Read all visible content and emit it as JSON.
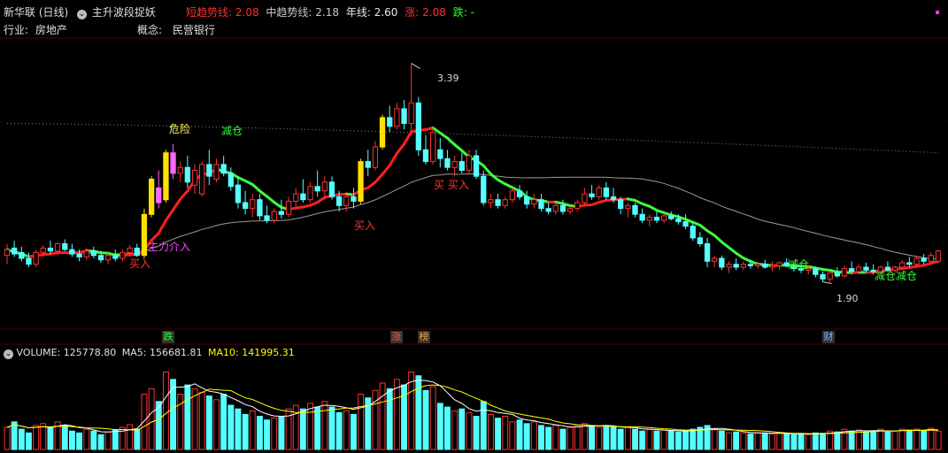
{
  "header": {
    "stock_name": "新华联 (日线)",
    "indicator_name": "主升波段捉妖",
    "short_trend_label": "短趋势线:",
    "short_trend_value": "2.08",
    "mid_trend_label": "中趋势线:",
    "mid_trend_value": "2.18",
    "year_line_label": "年线:",
    "year_line_value": "2.60",
    "rise_label": "涨:",
    "rise_value": "2.08",
    "fall_label": "跌:",
    "fall_value": "-",
    "industry_label": "行业:",
    "industry_value": "房地产",
    "concept_label": "概念:",
    "concept_value": "民营银行"
  },
  "volume_header": {
    "volume_label": "VOLUME:",
    "volume_value": "125778.80",
    "ma5_label": "MA5:",
    "ma5_value": "156681.81",
    "ma10_label": "MA10:",
    "ma10_value": "141995.31"
  },
  "colors": {
    "up": "#ff3232",
    "down": "#54ffff",
    "red_line": "#ff1f1f",
    "green_line": "#3cff3c",
    "year_line": "#9a9a9a",
    "dotted_line": "#707070",
    "yellow_candle": "#ffe000",
    "magenta_candle": "#ff66ff",
    "signal_buy": "#ff3333",
    "signal_reduce": "#33ff33",
    "signal_danger": "#ffff66",
    "signal_main": "#ff44ff",
    "ma5": "#ffffff",
    "ma10": "#ffff00",
    "badge_green": "#33ff33",
    "badge_red": "#ff5555",
    "badge_orange": "#ffa033",
    "badge_blue": "#77aaff"
  },
  "chart_data": {
    "type": "candlestick",
    "ylim": [
      1.65,
      3.55
    ],
    "max_label": "3.39",
    "min_label": "1.90",
    "candles": [
      {
        "o": 2.08,
        "h": 2.16,
        "l": 2.02,
        "c": 2.12
      },
      {
        "o": 2.13,
        "h": 2.18,
        "l": 2.07,
        "c": 2.09
      },
      {
        "o": 2.1,
        "h": 2.14,
        "l": 2.04,
        "c": 2.06
      },
      {
        "o": 2.06,
        "h": 2.1,
        "l": 2.0,
        "c": 2.02
      },
      {
        "o": 2.02,
        "h": 2.12,
        "l": 2.0,
        "c": 2.1
      },
      {
        "o": 2.1,
        "h": 2.15,
        "l": 2.07,
        "c": 2.13
      },
      {
        "o": 2.13,
        "h": 2.18,
        "l": 2.09,
        "c": 2.11
      },
      {
        "o": 2.11,
        "h": 2.17,
        "l": 2.08,
        "c": 2.16
      },
      {
        "o": 2.16,
        "h": 2.19,
        "l": 2.11,
        "c": 2.12
      },
      {
        "o": 2.12,
        "h": 2.16,
        "l": 2.07,
        "c": 2.09
      },
      {
        "o": 2.09,
        "h": 2.12,
        "l": 2.04,
        "c": 2.07
      },
      {
        "o": 2.07,
        "h": 2.13,
        "l": 2.05,
        "c": 2.11
      },
      {
        "o": 2.11,
        "h": 2.14,
        "l": 2.06,
        "c": 2.08
      },
      {
        "o": 2.08,
        "h": 2.11,
        "l": 2.03,
        "c": 2.05
      },
      {
        "o": 2.05,
        "h": 2.1,
        "l": 2.02,
        "c": 2.08
      },
      {
        "o": 2.08,
        "h": 2.12,
        "l": 2.04,
        "c": 2.06
      },
      {
        "o": 2.06,
        "h": 2.12,
        "l": 2.04,
        "c": 2.1
      },
      {
        "o": 2.1,
        "h": 2.15,
        "l": 2.07,
        "c": 2.13
      },
      {
        "o": 2.13,
        "h": 2.16,
        "l": 2.07,
        "c": 2.08
      },
      {
        "o": 2.08,
        "h": 2.4,
        "l": 2.06,
        "c": 2.36
      },
      {
        "o": 2.36,
        "h": 2.62,
        "l": 2.34,
        "c": 2.6
      },
      {
        "o": 2.54,
        "h": 2.66,
        "l": 2.4,
        "c": 2.44
      },
      {
        "o": 2.46,
        "h": 2.8,
        "l": 2.44,
        "c": 2.78
      },
      {
        "o": 2.78,
        "h": 2.84,
        "l": 2.6,
        "c": 2.64
      },
      {
        "o": 2.64,
        "h": 2.72,
        "l": 2.58,
        "c": 2.68
      },
      {
        "o": 2.68,
        "h": 2.76,
        "l": 2.54,
        "c": 2.58
      },
      {
        "o": 2.56,
        "h": 2.7,
        "l": 2.5,
        "c": 2.66
      },
      {
        "o": 2.5,
        "h": 2.72,
        "l": 2.48,
        "c": 2.7
      },
      {
        "o": 2.7,
        "h": 2.8,
        "l": 2.56,
        "c": 2.62
      },
      {
        "o": 2.6,
        "h": 2.74,
        "l": 2.58,
        "c": 2.7
      },
      {
        "o": 2.7,
        "h": 2.76,
        "l": 2.62,
        "c": 2.64
      },
      {
        "o": 2.64,
        "h": 2.68,
        "l": 2.52,
        "c": 2.55
      },
      {
        "o": 2.56,
        "h": 2.62,
        "l": 2.4,
        "c": 2.44
      },
      {
        "o": 2.44,
        "h": 2.52,
        "l": 2.36,
        "c": 2.4
      },
      {
        "o": 2.4,
        "h": 2.5,
        "l": 2.34,
        "c": 2.46
      },
      {
        "o": 2.46,
        "h": 2.5,
        "l": 2.32,
        "c": 2.35
      },
      {
        "o": 2.35,
        "h": 2.42,
        "l": 2.3,
        "c": 2.32
      },
      {
        "o": 2.32,
        "h": 2.4,
        "l": 2.3,
        "c": 2.38
      },
      {
        "o": 2.38,
        "h": 2.46,
        "l": 2.33,
        "c": 2.36
      },
      {
        "o": 2.36,
        "h": 2.48,
        "l": 2.34,
        "c": 2.45
      },
      {
        "o": 2.45,
        "h": 2.54,
        "l": 2.4,
        "c": 2.5
      },
      {
        "o": 2.5,
        "h": 2.6,
        "l": 2.44,
        "c": 2.46
      },
      {
        "o": 2.46,
        "h": 2.58,
        "l": 2.44,
        "c": 2.55
      },
      {
        "o": 2.55,
        "h": 2.66,
        "l": 2.48,
        "c": 2.52
      },
      {
        "o": 2.52,
        "h": 2.62,
        "l": 2.46,
        "c": 2.58
      },
      {
        "o": 2.58,
        "h": 2.62,
        "l": 2.46,
        "c": 2.48
      },
      {
        "o": 2.48,
        "h": 2.52,
        "l": 2.38,
        "c": 2.42
      },
      {
        "o": 2.42,
        "h": 2.5,
        "l": 2.38,
        "c": 2.48
      },
      {
        "o": 2.48,
        "h": 2.54,
        "l": 2.4,
        "c": 2.45
      },
      {
        "o": 2.45,
        "h": 2.74,
        "l": 2.43,
        "c": 2.72
      },
      {
        "o": 2.72,
        "h": 2.8,
        "l": 2.62,
        "c": 2.68
      },
      {
        "o": 2.68,
        "h": 2.86,
        "l": 2.66,
        "c": 2.82
      },
      {
        "o": 2.82,
        "h": 3.04,
        "l": 2.8,
        "c": 3.02
      },
      {
        "o": 3.02,
        "h": 3.1,
        "l": 2.92,
        "c": 2.96
      },
      {
        "o": 2.96,
        "h": 3.12,
        "l": 2.94,
        "c": 3.08
      },
      {
        "o": 3.08,
        "h": 3.14,
        "l": 2.94,
        "c": 2.98
      },
      {
        "o": 2.98,
        "h": 3.39,
        "l": 2.9,
        "c": 3.12
      },
      {
        "o": 3.12,
        "h": 3.16,
        "l": 2.76,
        "c": 2.8
      },
      {
        "o": 2.8,
        "h": 2.9,
        "l": 2.7,
        "c": 2.72
      },
      {
        "o": 2.72,
        "h": 2.96,
        "l": 2.7,
        "c": 2.92
      },
      {
        "o": 2.8,
        "h": 2.88,
        "l": 2.68,
        "c": 2.74
      },
      {
        "o": 2.74,
        "h": 2.8,
        "l": 2.66,
        "c": 2.68
      },
      {
        "o": 2.68,
        "h": 2.76,
        "l": 2.62,
        "c": 2.72
      },
      {
        "o": 2.72,
        "h": 2.78,
        "l": 2.64,
        "c": 2.66
      },
      {
        "o": 2.66,
        "h": 2.8,
        "l": 2.64,
        "c": 2.76
      },
      {
        "o": 2.76,
        "h": 2.8,
        "l": 2.6,
        "c": 2.62
      },
      {
        "o": 2.62,
        "h": 2.66,
        "l": 2.42,
        "c": 2.44
      },
      {
        "o": 2.44,
        "h": 2.5,
        "l": 2.4,
        "c": 2.46
      },
      {
        "o": 2.46,
        "h": 2.5,
        "l": 2.4,
        "c": 2.42
      },
      {
        "o": 2.42,
        "h": 2.48,
        "l": 2.4,
        "c": 2.46
      },
      {
        "o": 2.46,
        "h": 2.54,
        "l": 2.44,
        "c": 2.52
      },
      {
        "o": 2.52,
        "h": 2.56,
        "l": 2.46,
        "c": 2.48
      },
      {
        "o": 2.48,
        "h": 2.52,
        "l": 2.4,
        "c": 2.43
      },
      {
        "o": 2.43,
        "h": 2.5,
        "l": 2.4,
        "c": 2.46
      },
      {
        "o": 2.46,
        "h": 2.5,
        "l": 2.38,
        "c": 2.4
      },
      {
        "o": 2.4,
        "h": 2.44,
        "l": 2.36,
        "c": 2.38
      },
      {
        "o": 2.38,
        "h": 2.44,
        "l": 2.36,
        "c": 2.42
      },
      {
        "o": 2.42,
        "h": 2.46,
        "l": 2.36,
        "c": 2.38
      },
      {
        "o": 2.38,
        "h": 2.42,
        "l": 2.36,
        "c": 2.4
      },
      {
        "o": 2.4,
        "h": 2.46,
        "l": 2.38,
        "c": 2.44
      },
      {
        "o": 2.44,
        "h": 2.54,
        "l": 2.42,
        "c": 2.5
      },
      {
        "o": 2.5,
        "h": 2.56,
        "l": 2.46,
        "c": 2.48
      },
      {
        "o": 2.48,
        "h": 2.56,
        "l": 2.46,
        "c": 2.54
      },
      {
        "o": 2.54,
        "h": 2.58,
        "l": 2.46,
        "c": 2.48
      },
      {
        "o": 2.48,
        "h": 2.54,
        "l": 2.44,
        "c": 2.46
      },
      {
        "o": 2.46,
        "h": 2.48,
        "l": 2.36,
        "c": 2.4
      },
      {
        "o": 2.4,
        "h": 2.44,
        "l": 2.34,
        "c": 2.42
      },
      {
        "o": 2.42,
        "h": 2.44,
        "l": 2.34,
        "c": 2.36
      },
      {
        "o": 2.36,
        "h": 2.4,
        "l": 2.3,
        "c": 2.32
      },
      {
        "o": 2.32,
        "h": 2.36,
        "l": 2.28,
        "c": 2.34
      },
      {
        "o": 2.34,
        "h": 2.38,
        "l": 2.3,
        "c": 2.32
      },
      {
        "o": 2.32,
        "h": 2.37,
        "l": 2.3,
        "c": 2.35
      },
      {
        "o": 2.35,
        "h": 2.38,
        "l": 2.32,
        "c": 2.33
      },
      {
        "o": 2.33,
        "h": 2.36,
        "l": 2.29,
        "c": 2.31
      },
      {
        "o": 2.31,
        "h": 2.36,
        "l": 2.26,
        "c": 2.28
      },
      {
        "o": 2.28,
        "h": 2.3,
        "l": 2.18,
        "c": 2.2
      },
      {
        "o": 2.2,
        "h": 2.24,
        "l": 2.14,
        "c": 2.16
      },
      {
        "o": 2.16,
        "h": 2.2,
        "l": 2.0,
        "c": 2.04
      },
      {
        "o": 2.04,
        "h": 2.08,
        "l": 2.0,
        "c": 2.06
      },
      {
        "o": 2.06,
        "h": 2.08,
        "l": 1.98,
        "c": 2.0
      },
      {
        "o": 2.0,
        "h": 2.04,
        "l": 1.96,
        "c": 2.02
      },
      {
        "o": 2.02,
        "h": 2.06,
        "l": 1.98,
        "c": 2.0
      },
      {
        "o": 2.0,
        "h": 2.04,
        "l": 1.98,
        "c": 2.02
      },
      {
        "o": 2.02,
        "h": 2.05,
        "l": 1.99,
        "c": 2.01
      },
      {
        "o": 2.01,
        "h": 2.04,
        "l": 1.99,
        "c": 2.02
      },
      {
        "o": 2.02,
        "h": 2.05,
        "l": 1.99,
        "c": 2.0
      },
      {
        "o": 2.0,
        "h": 2.04,
        "l": 1.97,
        "c": 2.01
      },
      {
        "o": 2.01,
        "h": 2.04,
        "l": 1.98,
        "c": 2.03
      },
      {
        "o": 2.03,
        "h": 2.06,
        "l": 2.0,
        "c": 2.01
      },
      {
        "o": 2.01,
        "h": 2.03,
        "l": 1.97,
        "c": 1.99
      },
      {
        "o": 1.99,
        "h": 2.01,
        "l": 1.96,
        "c": 1.98
      },
      {
        "o": 1.98,
        "h": 2.01,
        "l": 1.95,
        "c": 1.99
      },
      {
        "o": 1.99,
        "h": 2.0,
        "l": 1.93,
        "c": 1.95
      },
      {
        "o": 1.95,
        "h": 1.97,
        "l": 1.9,
        "c": 1.92
      },
      {
        "o": 1.92,
        "h": 1.97,
        "l": 1.9,
        "c": 1.96
      },
      {
        "o": 1.96,
        "h": 2.0,
        "l": 1.93,
        "c": 1.94
      },
      {
        "o": 1.94,
        "h": 2.01,
        "l": 1.93,
        "c": 1.99
      },
      {
        "o": 1.99,
        "h": 2.04,
        "l": 1.95,
        "c": 1.97
      },
      {
        "o": 1.97,
        "h": 2.02,
        "l": 1.95,
        "c": 2.0
      },
      {
        "o": 2.0,
        "h": 2.03,
        "l": 1.96,
        "c": 1.98
      },
      {
        "o": 1.98,
        "h": 2.02,
        "l": 1.95,
        "c": 1.97
      },
      {
        "o": 1.97,
        "h": 2.01,
        "l": 1.95,
        "c": 2.0
      },
      {
        "o": 2.0,
        "h": 2.04,
        "l": 1.97,
        "c": 1.98
      },
      {
        "o": 1.98,
        "h": 2.01,
        "l": 1.96,
        "c": 2.0
      },
      {
        "o": 2.0,
        "h": 2.05,
        "l": 1.98,
        "c": 2.03
      },
      {
        "o": 2.03,
        "h": 2.07,
        "l": 2.0,
        "c": 2.02
      },
      {
        "o": 2.02,
        "h": 2.08,
        "l": 2.0,
        "c": 2.06
      },
      {
        "o": 2.06,
        "h": 2.09,
        "l": 2.02,
        "c": 2.04
      },
      {
        "o": 2.04,
        "h": 2.1,
        "l": 2.02,
        "c": 2.08
      },
      {
        "o": 2.04,
        "h": 2.12,
        "l": 2.03,
        "c": 2.11
      }
    ],
    "volume": [
      120,
      150,
      110,
      90,
      130,
      140,
      120,
      150,
      130,
      100,
      90,
      110,
      100,
      80,
      95,
      105,
      120,
      135,
      110,
      300,
      330,
      260,
      420,
      380,
      300,
      350,
      330,
      310,
      290,
      270,
      300,
      240,
      220,
      190,
      210,
      180,
      160,
      170,
      180,
      220,
      240,
      220,
      250,
      230,
      260,
      230,
      200,
      210,
      190,
      300,
      280,
      320,
      360,
      330,
      380,
      350,
      420,
      400,
      320,
      340,
      250,
      230,
      210,
      220,
      200,
      180,
      260,
      190,
      170,
      180,
      150,
      160,
      140,
      150,
      130,
      120,
      130,
      110,
      120,
      130,
      140,
      130,
      120,
      130,
      120,
      110,
      120,
      110,
      100,
      110,
      100,
      105,
      100,
      95,
      100,
      110,
      120,
      130,
      110,
      100,
      90,
      95,
      90,
      85,
      90,
      88,
      85,
      90,
      85,
      80,
      85,
      80,
      90,
      88,
      100,
      95,
      110,
      100,
      105,
      95,
      100,
      110,
      95,
      100,
      110,
      105,
      110,
      100,
      115,
      100
    ],
    "volume_ylim": [
      0,
      480
    ]
  },
  "signals": {
    "buy_1": "买入",
    "main_force": "主力介入",
    "danger": "危险",
    "reduce_1": "减仓",
    "buy_2": "买入",
    "buy_3": "买 买入",
    "reduce_2": "减仓",
    "reduce_3": "减仓减仓"
  },
  "badges": {
    "fall": "跌",
    "rise": "涨",
    "list": "榜",
    "finance": "财"
  }
}
